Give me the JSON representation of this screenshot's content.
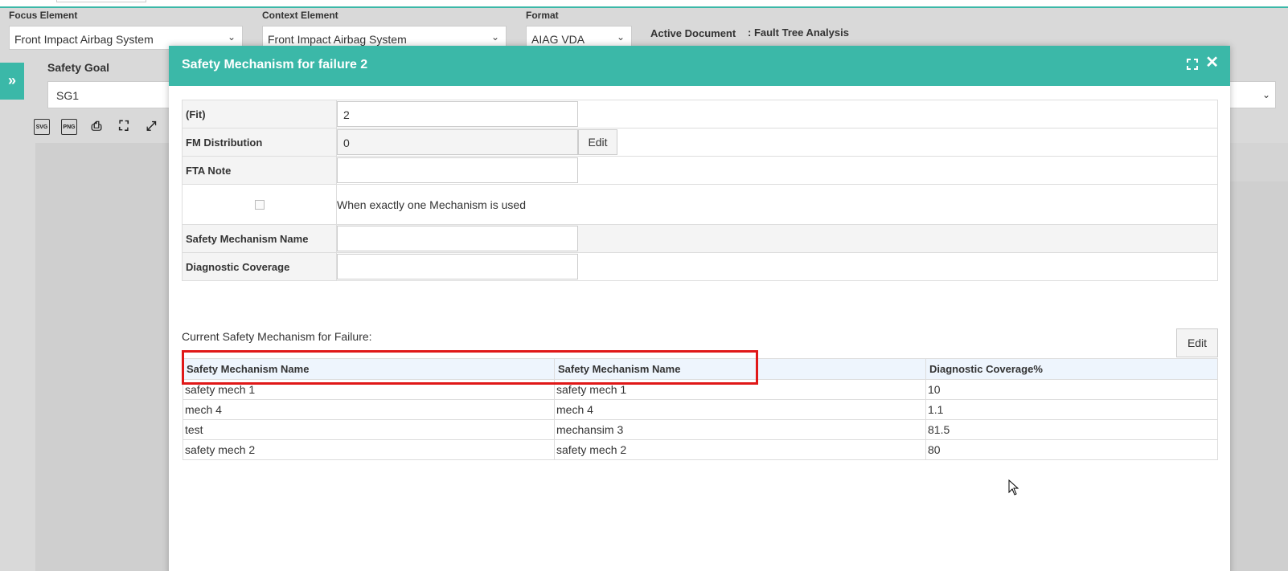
{
  "filters": {
    "focus_label": "Focus Element",
    "focus_value": "Front Impact Airbag System",
    "context_label": "Context Element",
    "context_value": "Front Impact Airbag System",
    "format_label": "Format",
    "format_value": "AIAG VDA",
    "active_doc_label": "Active Document",
    "active_doc_value": ": Fault Tree Analysis"
  },
  "safety_goal": {
    "label": "Safety Goal",
    "value": "SG1"
  },
  "modal": {
    "title": "Safety Mechanism for failure 2",
    "fields": {
      "fit_label": "(Fit)",
      "fit_value": "2",
      "fm_label": "FM Distribution",
      "fm_value": "0",
      "fm_edit": "Edit",
      "fta_label": "FTA Note",
      "fta_value": "",
      "checkbox_text": "When exactly one Mechanism is used",
      "sm_name_label": "Safety Mechanism Name",
      "sm_name_value": "",
      "dc_label": "Diagnostic Coverage",
      "dc_value": ""
    },
    "current_label": "Current Safety Mechanism for Failure:",
    "current_edit": "Edit",
    "table": {
      "headers": [
        "Safety Mechanism Name",
        "Safety Mechanism Name",
        "Diagnostic Coverage%"
      ],
      "rows": [
        [
          "safety mech 1",
          "safety mech 1",
          "10"
        ],
        [
          "mech 4",
          "mech 4",
          "1.1"
        ],
        [
          "test",
          "mechansim 3",
          "81.5"
        ],
        [
          "safety mech 2",
          "safety mech 2",
          "80"
        ]
      ]
    }
  },
  "colors": {
    "accent": "#3bb8a8",
    "highlight": "#e01818"
  }
}
